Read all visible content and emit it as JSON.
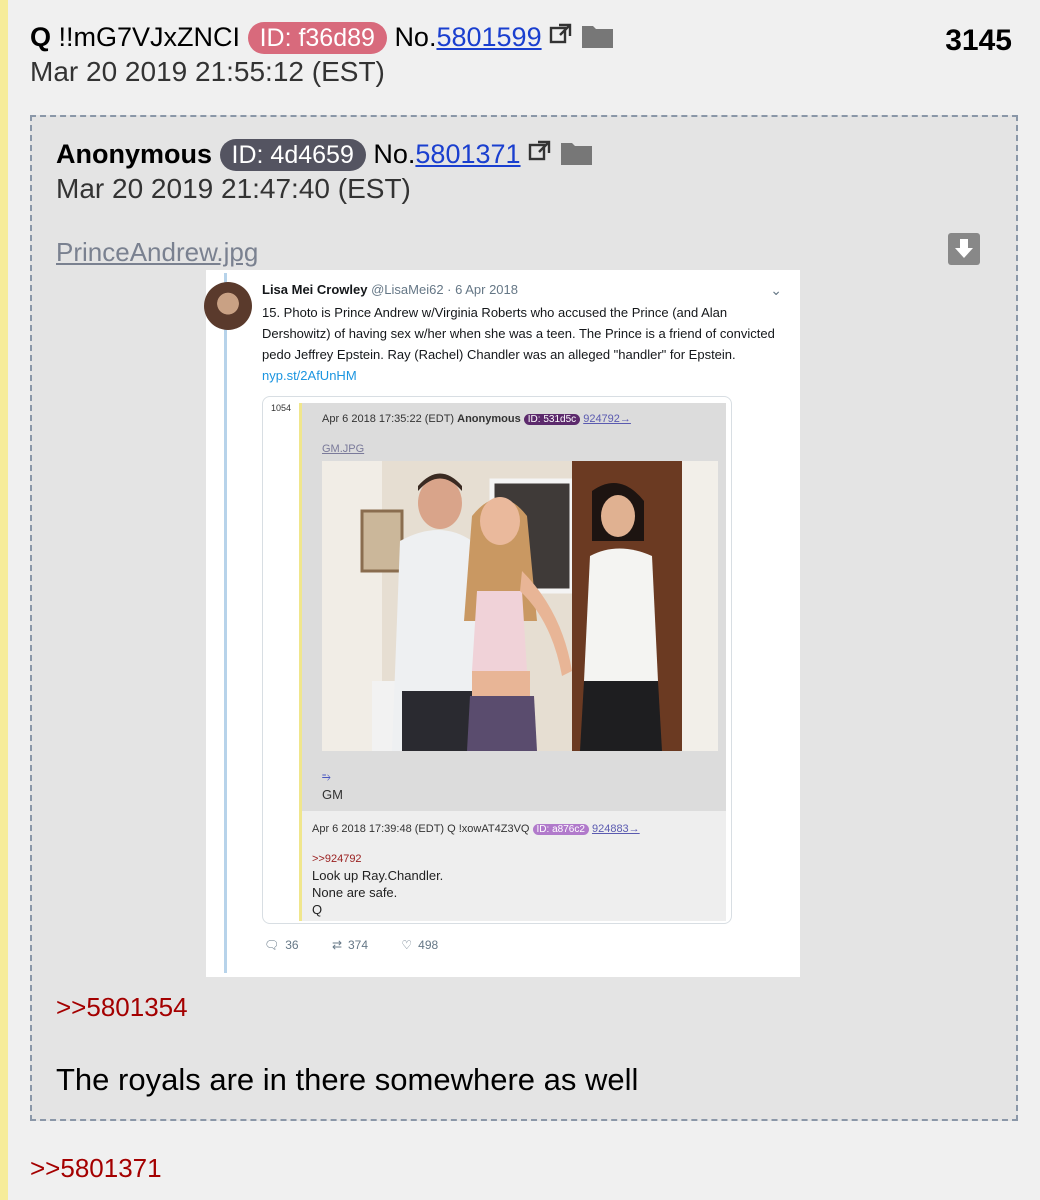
{
  "post": {
    "name": "Q",
    "tripcode": "!!mG7VJxZNCI",
    "id_label": "ID: f36d89",
    "no_prefix": "No.",
    "post_number": "5801599",
    "datetime": "Mar 20 2019 21:55:12 (EST)",
    "count": "3145",
    "reply_link": ">>5801371"
  },
  "quoted": {
    "name": "Anonymous",
    "id_label": "ID: 4d4659",
    "no_prefix": "No.",
    "post_number": "5801371",
    "datetime": "Mar 20 2019 21:47:40 (EST)",
    "filename": "PrinceAndrew.jpg",
    "reply_link": ">>5801354",
    "message": "The royals are in there somewhere as well"
  },
  "tweet": {
    "author": "Lisa Mei Crowley",
    "handle_date": "@LisaMei62 · 6 Apr 2018",
    "text": "15. Photo is Prince Andrew w/Virginia Roberts who accused the Prince (and Alan Dershowitz) of having sex w/her when she was a teen. The Prince is a friend of convicted pedo Jeffrey Epstein. Ray (Rachel) Chandler was an alleged \"handler\" for Epstein.",
    "link": "nyp.st/2AfUnHM",
    "card": {
      "number": "1054",
      "post1": {
        "date": "Apr 6 2018 17:35:22 (EDT)",
        "name": "Anonymous",
        "id": "ID: 531d5c",
        "link": "924792→",
        "file": "GM.JPG",
        "arrow": "⥱",
        "caption": "GM"
      },
      "post2": {
        "date": "Apr 6 2018 17:39:48 (EDT)",
        "name": "Q !xowAT4Z3VQ",
        "id": "ID: a876c2",
        "link": "924883→",
        "quote": ">>924792",
        "lines": [
          "Look up Ray.Chandler.",
          "None are safe.",
          "Q"
        ]
      }
    },
    "replies": "36",
    "retweets": "374",
    "likes": "498"
  },
  "icons": {
    "external_link": "external-link-icon",
    "folder": "folder-icon",
    "download": "download-icon",
    "reply": "reply-icon",
    "retweet": "retweet-icon",
    "like": "heart-icon"
  },
  "colors": {
    "q_id_badge": "#d86a7c",
    "anon_id_badge": "#545461",
    "link_blue": "#1a3fcf",
    "reply_red": "#a40000",
    "side_bar": "#f6ec9a"
  }
}
